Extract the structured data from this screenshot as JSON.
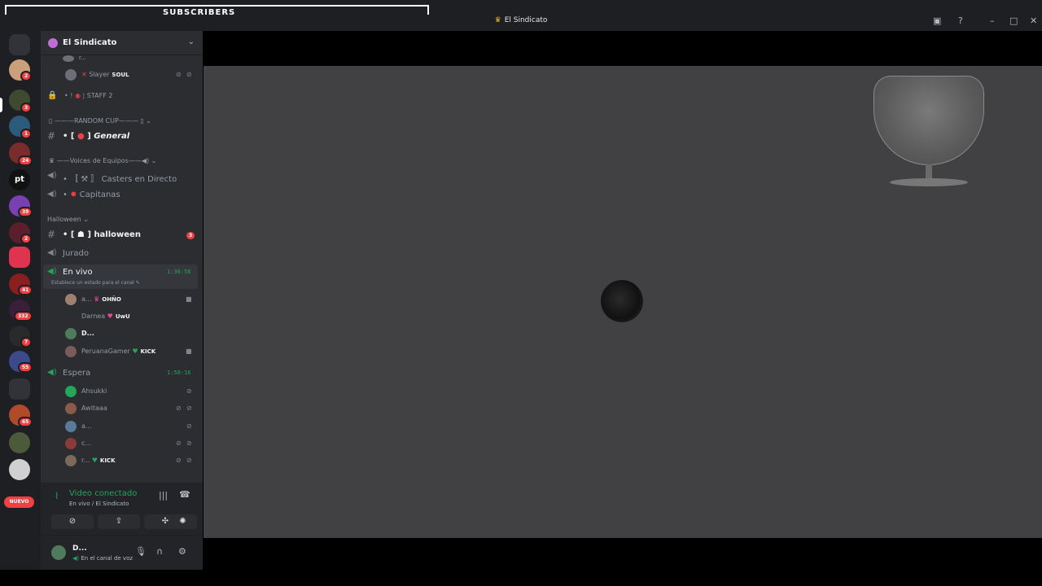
{
  "overlay_banner": "SUBSCRIBERS",
  "window": {
    "title": "El Sindicato",
    "controls": [
      "inbox",
      "help",
      "minimize",
      "maximize",
      "close"
    ]
  },
  "servers": {
    "badges": [
      "2",
      "3",
      "1",
      "24",
      "39",
      "2",
      "41",
      "332",
      "7",
      "55",
      "65"
    ],
    "initials": "pt",
    "nuevo": "NUEVO",
    "colors": {
      "accent": "#f23f43",
      "brand": "#5865f2"
    }
  },
  "guild": {
    "name": "El Sindicato"
  },
  "channels": {
    "top_partial_user": "r...",
    "slayer": {
      "name": "Slayer",
      "tag": "SOUL"
    },
    "staff": "STAFF 2",
    "cat_random_cup": "RANDOM CUP",
    "general": {
      "prefix": "• [",
      "name": "General"
    },
    "cat_voices": "Voices de Equipos",
    "casters": "Casters en Directo",
    "capitanas": "Capitanas",
    "cat_halloween": "Halloween",
    "halloween": {
      "name": "halloween",
      "badge": "3"
    },
    "jurado": "Jurado",
    "en_vivo": {
      "name": "En vivo",
      "timer": "1:36:58",
      "status_hint": "Establece un estado para el canal"
    },
    "en_vivo_users": [
      {
        "name": "a...",
        "tag": "OHÑO"
      },
      {
        "name": "Darnea",
        "tag": "UwU"
      },
      {
        "name": "D...",
        "tag": ""
      },
      {
        "name": "PeruanaGamer",
        "tag": "KICK"
      }
    ],
    "espera": {
      "name": "Espera",
      "timer": "1:50:16"
    },
    "espera_users": [
      {
        "name": "Ahsukki",
        "tag": ""
      },
      {
        "name": "Awitaaa",
        "tag": ""
      },
      {
        "name": "a...",
        "tag": ""
      },
      {
        "name": "c...",
        "tag": ""
      },
      {
        "name": "r...",
        "tag": "KICK"
      }
    ]
  },
  "voice_panel": {
    "status": "Video conectado",
    "location": "En vivo / El Sindicato"
  },
  "user_panel": {
    "name": "D...",
    "status": "En el canal de voz"
  }
}
